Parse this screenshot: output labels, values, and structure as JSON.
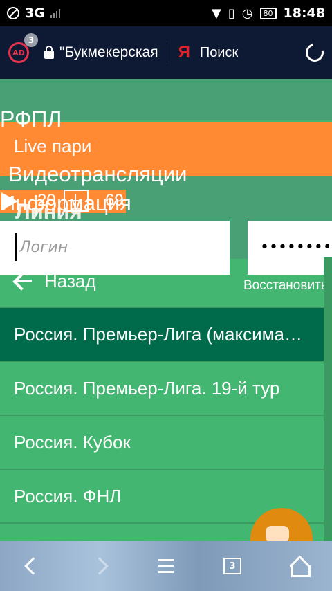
{
  "status_bar": {
    "network": "3G",
    "battery": "80",
    "time": "18:48"
  },
  "browser": {
    "ad_badge_count": "3",
    "ad_label": "AD",
    "url_text": "\"Букмекерская",
    "yandex_logo": "Я",
    "search_label": "Поиск"
  },
  "page": {
    "rfpl": "РФПЛ",
    "live": "Live пари",
    "video": "Видеотрансляции",
    "info": "Информация",
    "liniya": "Линия",
    "count_20": "20",
    "count_69": "69",
    "login_placeholder": "Логин",
    "password_value": "••••••••",
    "restore": "Восстановить",
    "back": "Назад",
    "leagues": [
      "Россия. Премьер-Лига (максимальный лимит)",
      "Россия. Премьер-Лига. 19-й тур",
      "Россия. Кубок",
      "Россия. ФНЛ"
    ]
  },
  "bottom_nav": {
    "tabs_count": "3"
  }
}
